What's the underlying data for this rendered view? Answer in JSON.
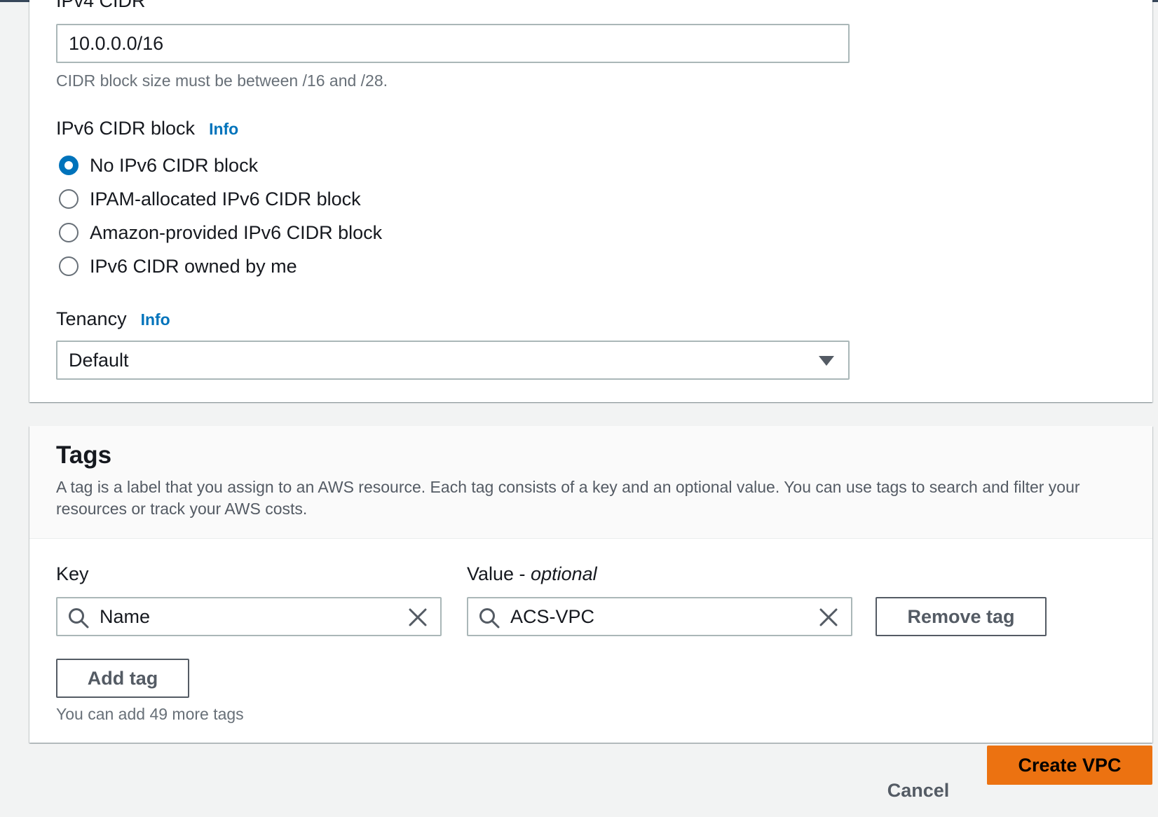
{
  "vpc_settings": {
    "ipv4_cidr": {
      "label": "IPv4 CIDR",
      "value": "10.0.0.0/16",
      "hint": "CIDR block size must be between /16 and /28."
    },
    "ipv6_cidr_block": {
      "label": "IPv6 CIDR block",
      "info": "Info",
      "options": [
        {
          "label": "No IPv6 CIDR block",
          "selected": true
        },
        {
          "label": "IPAM-allocated IPv6 CIDR block",
          "selected": false
        },
        {
          "label": "Amazon-provided IPv6 CIDR block",
          "selected": false
        },
        {
          "label": "IPv6 CIDR owned by me",
          "selected": false
        }
      ]
    },
    "tenancy": {
      "label": "Tenancy",
      "info": "Info",
      "selected": "Default"
    }
  },
  "tags": {
    "title": "Tags",
    "description": "A tag is a label that you assign to an AWS resource. Each tag consists of a key and an optional value. You can use tags to search and filter your resources or track your AWS costs.",
    "key_label": "Key",
    "value_label": "Value - ",
    "value_label_optional": "optional",
    "rows": [
      {
        "key": "Name",
        "value": "ACS-VPC"
      }
    ],
    "remove_tag_label": "Remove tag",
    "add_tag_label": "Add tag",
    "remaining_hint": "You can add 49 more tags"
  },
  "footer": {
    "cancel_label": "Cancel",
    "create_label": "Create VPC"
  },
  "colors": {
    "accent_blue": "#0073bb",
    "primary_orange": "#ec7211",
    "page_background": "#f2f3f3"
  },
  "icons": {
    "search": "search-icon",
    "clear": "close-icon",
    "dropdown": "caret-down-icon"
  }
}
